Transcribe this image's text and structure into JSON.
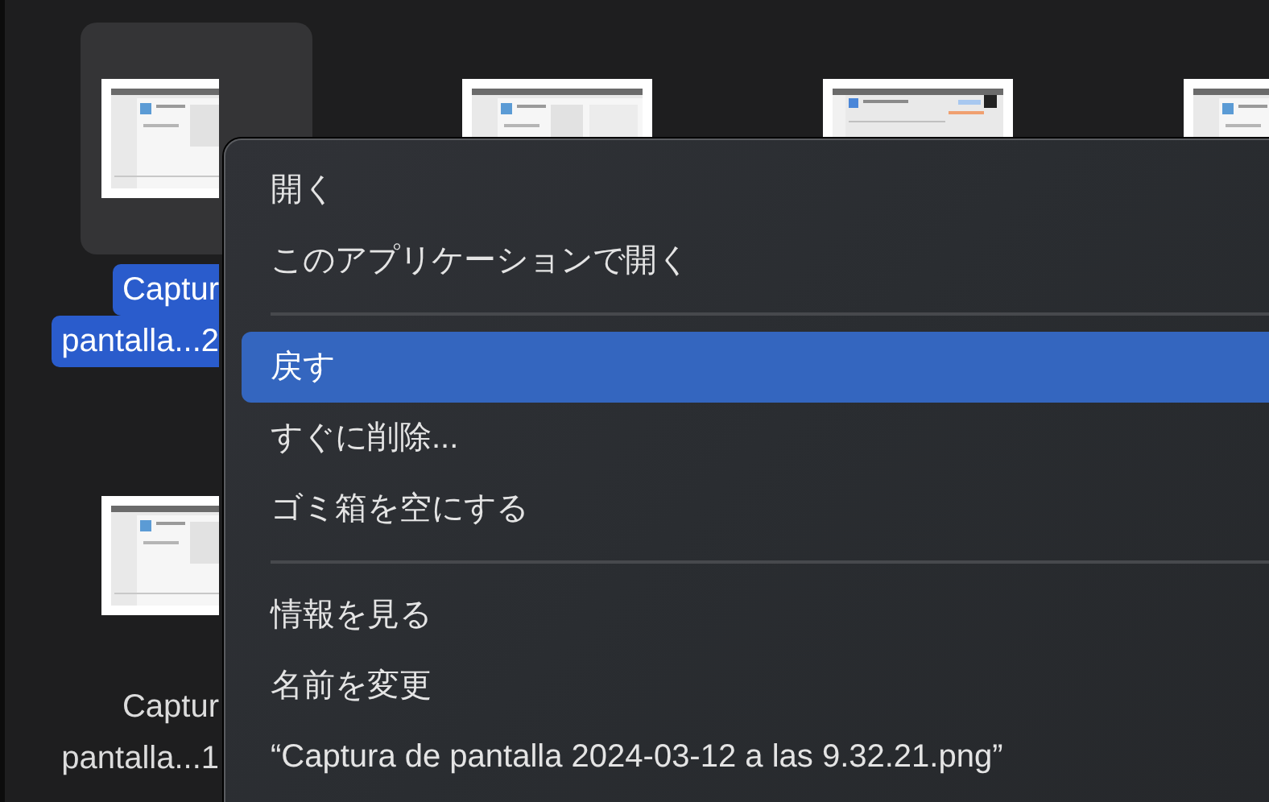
{
  "icons": [
    {
      "kind": "file",
      "selected": true,
      "label": [
        "Captur",
        "pantalla...2"
      ]
    },
    {
      "kind": "file",
      "selected": false
    },
    {
      "kind": "file",
      "selected": false
    },
    {
      "kind": "file",
      "selected": false
    },
    {
      "kind": "file",
      "selected": false,
      "label": [
        "Captur",
        "pantalla...1"
      ]
    }
  ],
  "context_menu": {
    "items": [
      {
        "kind": "item",
        "label": "開く",
        "selected": false
      },
      {
        "kind": "item",
        "label": "このアプリケーションで開く",
        "selected": false
      },
      {
        "kind": "separator"
      },
      {
        "kind": "item",
        "label": "戻す",
        "selected": true
      },
      {
        "kind": "item",
        "label": "すぐに削除...",
        "selected": false
      },
      {
        "kind": "item",
        "label": "ゴミ箱を空にする",
        "selected": false
      },
      {
        "kind": "separator"
      },
      {
        "kind": "item",
        "label": "情報を見る",
        "selected": false
      },
      {
        "kind": "item",
        "label": "名前を変更",
        "selected": false
      },
      {
        "kind": "item",
        "label": "“Captura de pantalla 2024-03-12 a las 9.32.21.png”",
        "selected": false
      }
    ]
  }
}
